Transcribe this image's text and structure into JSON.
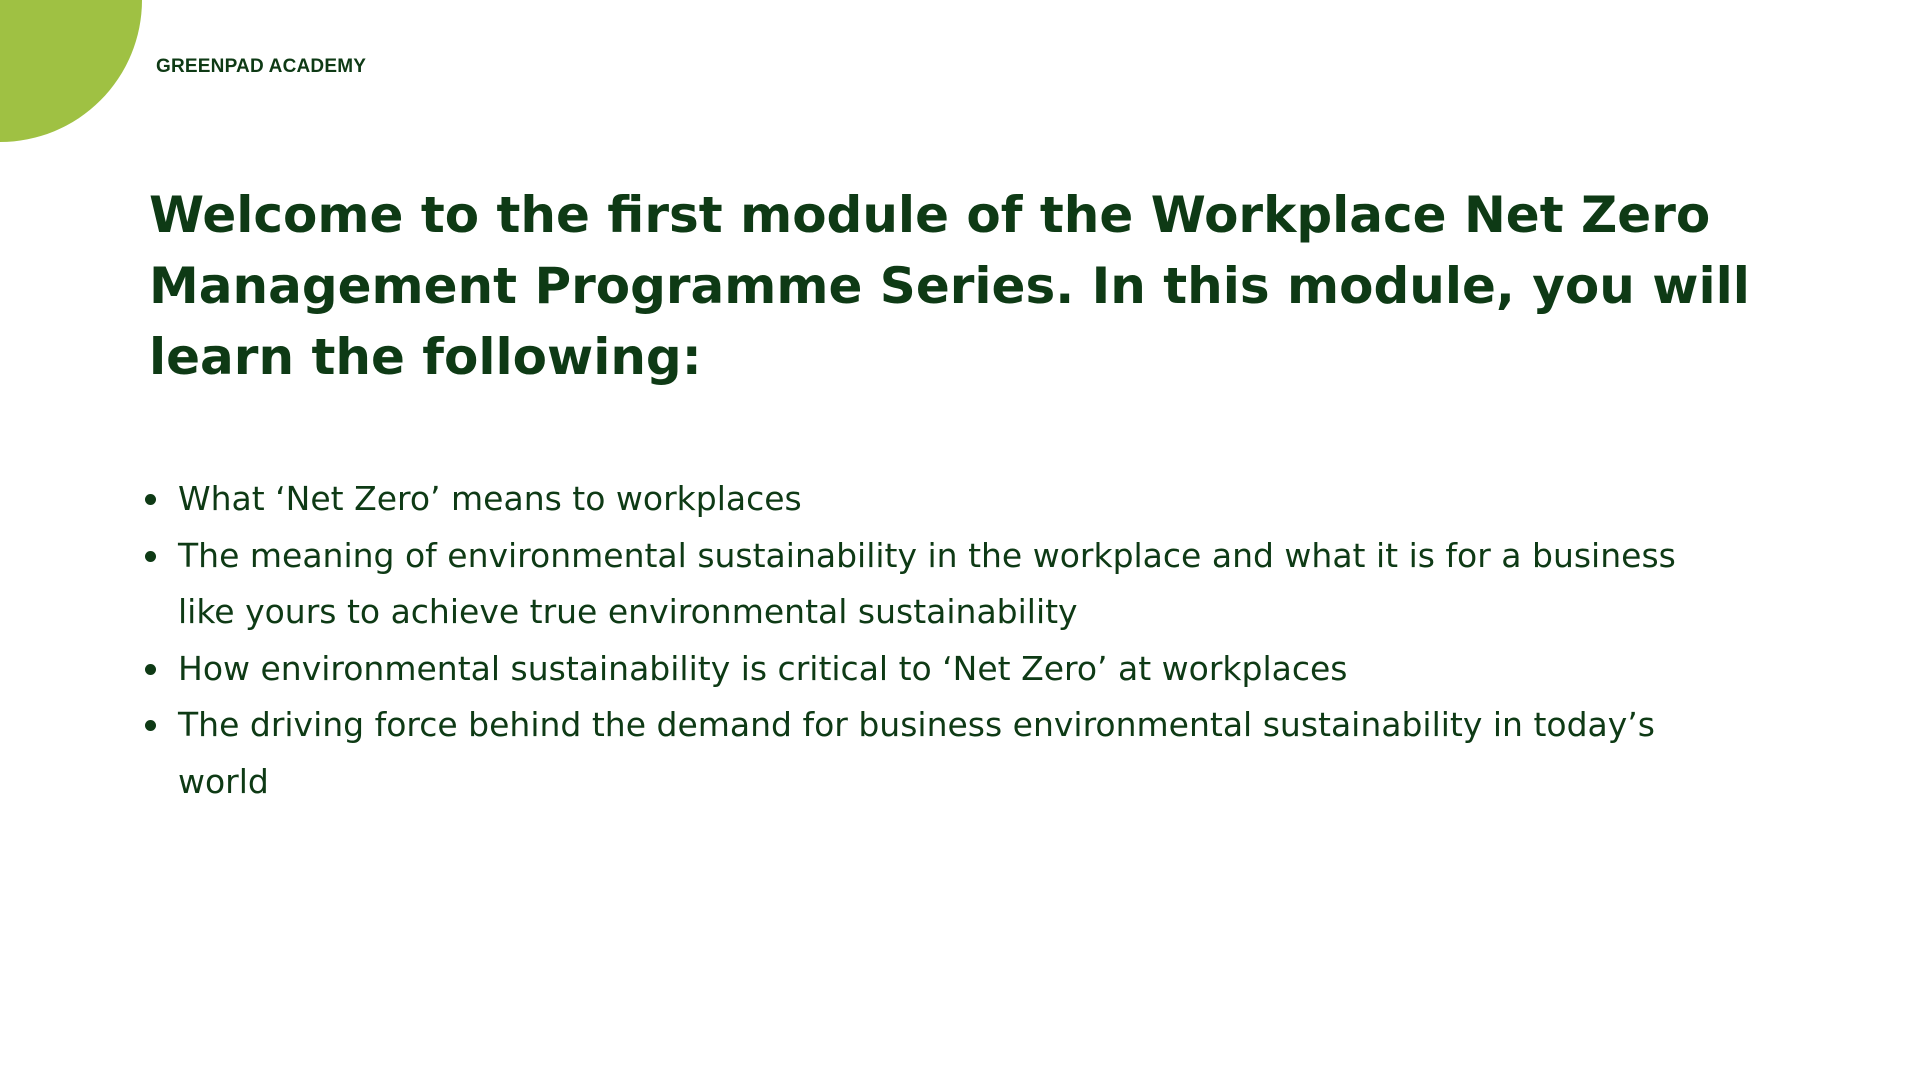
{
  "brand": {
    "name": "GREENPAD ACADEMY",
    "accent_color": "#9fc143",
    "text_color": "#0e3a15"
  },
  "headline": "Welcome to the first module of the Workplace Net Zero Management Programme Series. In this module, you will learn the following:",
  "objectives": [
    {
      "text": "What ‘Net Zero’ means to workplaces"
    },
    {
      "text": "The meaning of environmental sustainability in the workplace and what it is for a business like yours to achieve true environmental sustainability"
    },
    {
      "text": "How environmental sustainability is critical to ‘Net Zero’ at workplaces"
    },
    {
      "text": "The driving force behind the demand for business environmental sustainability in today’s world"
    }
  ]
}
